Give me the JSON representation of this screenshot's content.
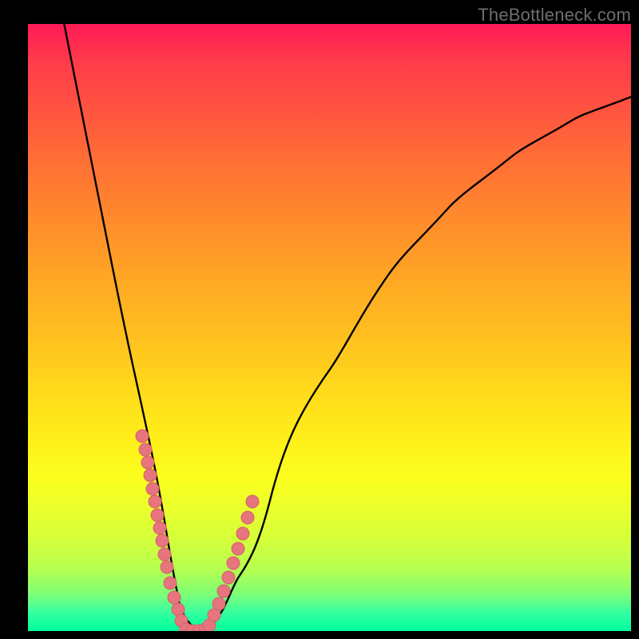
{
  "watermark": "TheBottleneck.com",
  "chart_data": {
    "type": "line",
    "title": "",
    "xlabel": "",
    "ylabel": "",
    "xlim": [
      0,
      100
    ],
    "ylim": [
      0,
      100
    ],
    "grid": false,
    "series": [
      {
        "name": "bottleneck-curve",
        "x": [
          6,
          8,
          10,
          12,
          14,
          16,
          18,
          20,
          21,
          22,
          23,
          24,
          25,
          26,
          28,
          30,
          32,
          35,
          40,
          45,
          50,
          55,
          60,
          65,
          70,
          75,
          80,
          85,
          90,
          95,
          100
        ],
        "y": [
          100,
          90,
          80,
          70,
          60,
          50,
          41,
          32,
          27,
          22,
          16,
          10,
          5,
          2,
          0,
          0,
          3,
          9,
          21,
          33,
          43,
          52,
          59,
          65,
          70,
          74,
          78,
          81,
          84,
          86,
          88
        ]
      }
    ],
    "markers": [
      {
        "name": "left-cluster",
        "x_approx": [
          19.0,
          19.4,
          19.8,
          20.2,
          20.6,
          21.0,
          21.4,
          21.8,
          22.2,
          22.6,
          23.0,
          23.6,
          24.2,
          24.8,
          25.4
        ],
        "note": "pink beads along descending branch"
      },
      {
        "name": "right-cluster",
        "x_approx": [
          30.0,
          30.8,
          31.6,
          32.4,
          33.2,
          34.0,
          34.8,
          35.6,
          36.4,
          37.2
        ],
        "note": "pink beads along ascending branch"
      },
      {
        "name": "bottom-cluster",
        "x_approx": [
          26.0,
          27.0,
          28.0,
          29.0
        ],
        "note": "pink beads across minimum"
      }
    ],
    "annotations": []
  },
  "colors": {
    "curve_stroke": "#000000",
    "marker_fill": "#e6757e",
    "marker_stroke": "#d85f6a",
    "background_frame": "#000000"
  }
}
